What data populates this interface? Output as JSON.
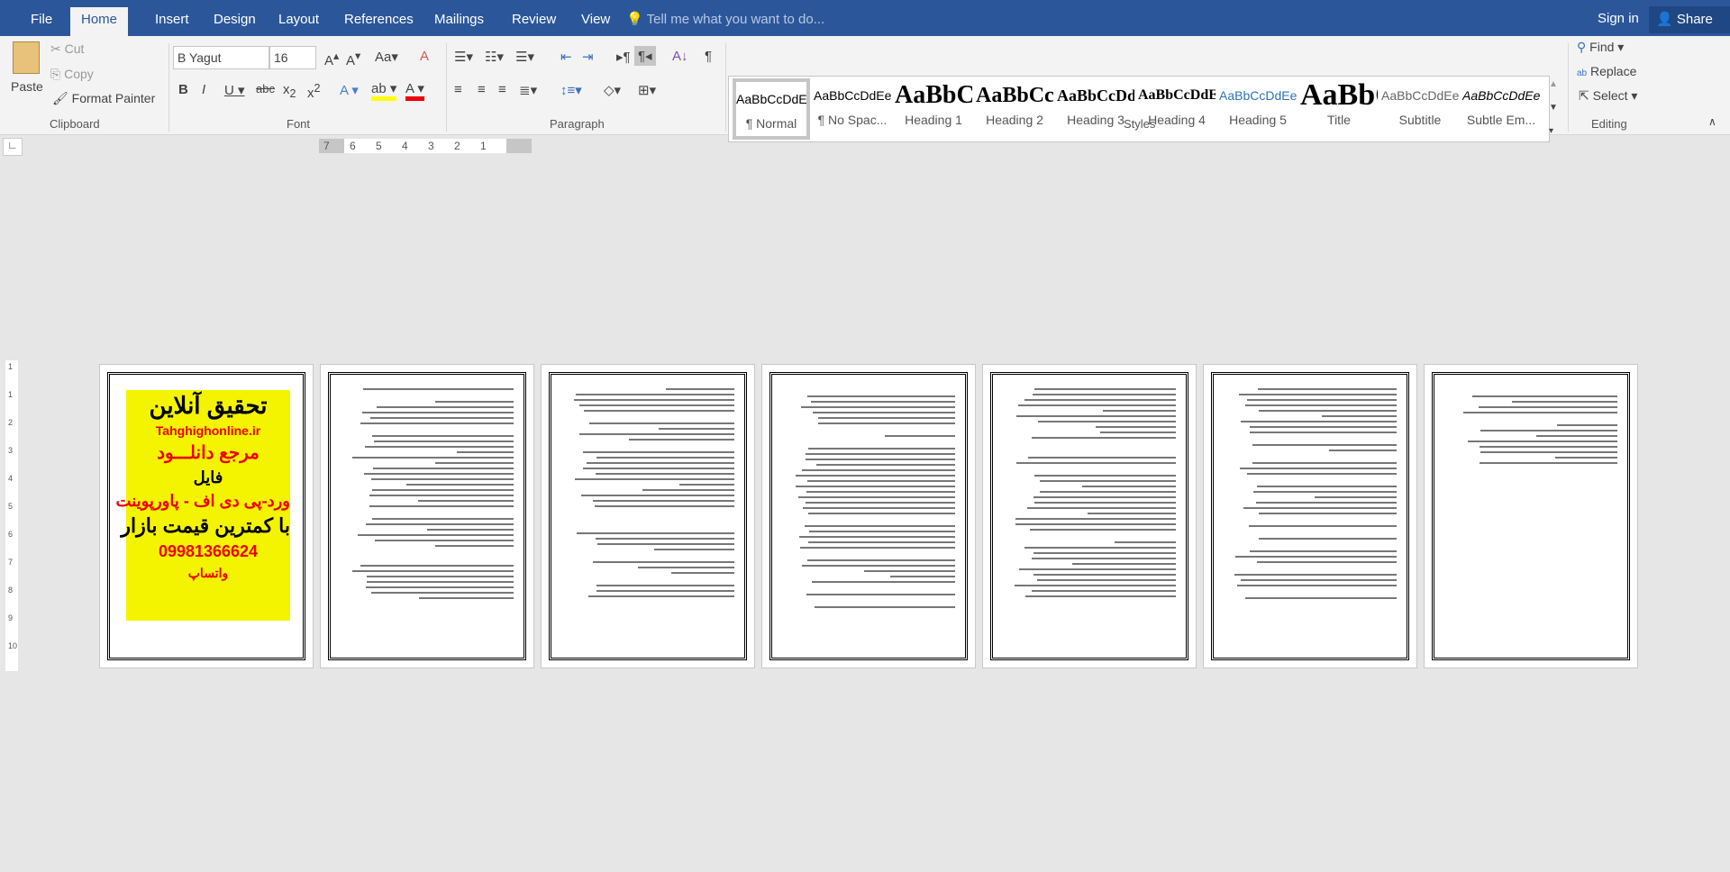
{
  "tabs": [
    "File",
    "Home",
    "Insert",
    "Design",
    "Layout",
    "References",
    "Mailings",
    "Review",
    "View"
  ],
  "active_tab": "Home",
  "tell_me": "Tell me what you want to do...",
  "sign_in": "Sign in",
  "share": "Share",
  "clipboard": {
    "paste": "Paste",
    "cut": "Cut",
    "copy": "Copy",
    "format_painter": "Format Painter",
    "label": "Clipboard"
  },
  "font": {
    "name": "B Yagut",
    "size": "16",
    "label": "Font"
  },
  "paragraph": {
    "label": "Paragraph"
  },
  "styles": {
    "label": "Styles",
    "items": [
      {
        "preview": "AaBbCcDdEe",
        "name": "¶ Normal"
      },
      {
        "preview": "AaBbCcDdEe",
        "name": "¶ No Spac..."
      },
      {
        "preview": "AaBbCcDdEe",
        "name": "Heading 1"
      },
      {
        "preview": "AaBbCcDdEe",
        "name": "Heading 2"
      },
      {
        "preview": "AaBbCcDdEe",
        "name": "Heading 3"
      },
      {
        "preview": "AaBbCcDdEe",
        "name": "Heading 4"
      },
      {
        "preview": "AaBbCcDdEe",
        "name": "Heading 5"
      },
      {
        "preview": "AaBbCcDdEe",
        "name": "Title"
      },
      {
        "preview": "AaBbCcDdEe",
        "name": "Subtitle"
      },
      {
        "preview": "AaBbCcDdEe",
        "name": "Subtle Em..."
      }
    ]
  },
  "editing": {
    "find": "Find",
    "replace": "Replace",
    "select": "Select",
    "label": "Editing"
  },
  "ruler": [
    "7",
    "6",
    "5",
    "4",
    "3",
    "2",
    "1"
  ],
  "vruler": [
    "1",
    "1",
    "2",
    "3",
    "4",
    "5",
    "6",
    "7",
    "8",
    "9",
    "10"
  ],
  "ad": {
    "title": "تحقیق آنلاین",
    "site": "Tahghighonline.ir",
    "line1": "مرجع دانلـــود",
    "line2": "فایل",
    "line3": "ورد-پی دی اف - پاورپوینت",
    "line4": "با کمترین قیمت بازار",
    "phone": "09981366624",
    "whatsapp": "واتساپ"
  }
}
